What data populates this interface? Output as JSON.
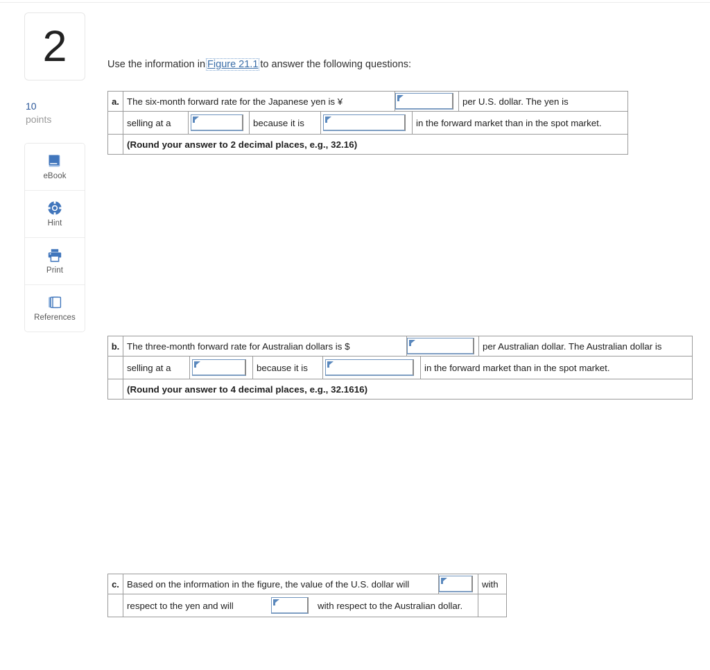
{
  "question": {
    "number": "2",
    "points_value": "10",
    "points_label": "points",
    "prompt_before_link": "Use the information in",
    "figure_link": "Figure 21.1",
    "prompt_after_link": "to answer the following questions:"
  },
  "tools": [
    {
      "label": "eBook",
      "icon": "ebook-icon"
    },
    {
      "label": "Hint",
      "icon": "life-ring-icon"
    },
    {
      "label": "Print",
      "icon": "printer-icon"
    },
    {
      "label": "References",
      "icon": "documents-icon"
    }
  ],
  "parts": {
    "a": {
      "letter": "a.",
      "line1_before_field": "The six-month forward rate for the Japanese yen is ¥",
      "line1_after_field": "per U.S. dollar. The yen is",
      "line2_segment1": "selling at a",
      "line2_segment2": "because it is",
      "line2_segment3": "in the forward market than in the spot market.",
      "rounding_note": "(Round your answer to 2 decimal places, e.g., 32.16)",
      "field_values": {
        "rate": "",
        "premium_discount": "",
        "more_less": ""
      }
    },
    "b": {
      "letter": "b.",
      "line1_before_field": "The three-month forward rate for Australian dollars is $",
      "line1_after_field": "per Australian dollar. The Australian dollar is",
      "line2_segment1": "selling at a",
      "line2_segment2": "because it is",
      "line2_segment3": "in the forward market than in the spot market.",
      "rounding_note": "(Round your answer to 4 decimal places, e.g., 32.1616)",
      "field_values": {
        "rate": "",
        "premium_discount": "",
        "more_less": ""
      }
    },
    "c": {
      "letter": "c.",
      "line1_before_field": "Based on the information in the figure, the value of the U.S. dollar will",
      "line1_after_field": "with",
      "line2_segment1": "respect to the yen and will",
      "line2_segment2": "with respect to the Australian dollar.",
      "field_values": {
        "yen_direction": "",
        "aud_direction": ""
      }
    }
  },
  "colors": {
    "points_accent": "#2a5699",
    "link": "#3b6ea8",
    "warning_red": "#e8170f",
    "icon_blue": "#4176bc",
    "table_border": "#9a9a9a",
    "field_border": "#6e93bd"
  }
}
